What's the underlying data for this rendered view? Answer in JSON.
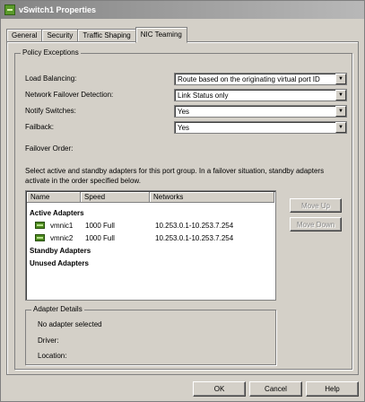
{
  "window": {
    "title": "vSwitch1 Properties"
  },
  "tabs": [
    "General",
    "Security",
    "Traffic Shaping",
    "NIC Teaming"
  ],
  "policy": {
    "group_title": "Policy Exceptions",
    "fields": [
      {
        "label": "Load Balancing:",
        "value": "Route based on the originating virtual port ID"
      },
      {
        "label": "Network Failover Detection:",
        "value": "Link Status only"
      },
      {
        "label": "Notify Switches:",
        "value": "Yes"
      },
      {
        "label": "Failback:",
        "value": "Yes"
      }
    ],
    "failover_order_label": "Failover Order:",
    "instructions": "Select active and standby adapters for this port group.  In a failover situation, standby adapters activate  in the order specified below."
  },
  "adapters": {
    "columns": [
      "Name",
      "Speed",
      "Networks"
    ],
    "active_label": "Active Adapters",
    "active": [
      {
        "name": "vmnic1",
        "speed": "1000 Full",
        "networks": "10.253.0.1-10.253.7.254"
      },
      {
        "name": "vmnic2",
        "speed": "1000 Full",
        "networks": "10.253.0.1-10.253.7.254"
      }
    ],
    "standby_label": "Standby Adapters",
    "unused_label": "Unused Adapters"
  },
  "move_up_label": "Move Up",
  "move_down_label": "Move Down",
  "details": {
    "title": "Adapter Details",
    "selected": "No adapter selected",
    "driver_label": "Driver:",
    "location_label": "Location:"
  },
  "buttons": {
    "ok": "OK",
    "cancel": "Cancel",
    "help": "Help"
  },
  "icons": {
    "app": "vswitch-icon",
    "adapter": "nic-icon"
  },
  "colors": {
    "face": "#d4d0c8",
    "title_start": "#848484",
    "nic_green": "#4d8a1f"
  }
}
